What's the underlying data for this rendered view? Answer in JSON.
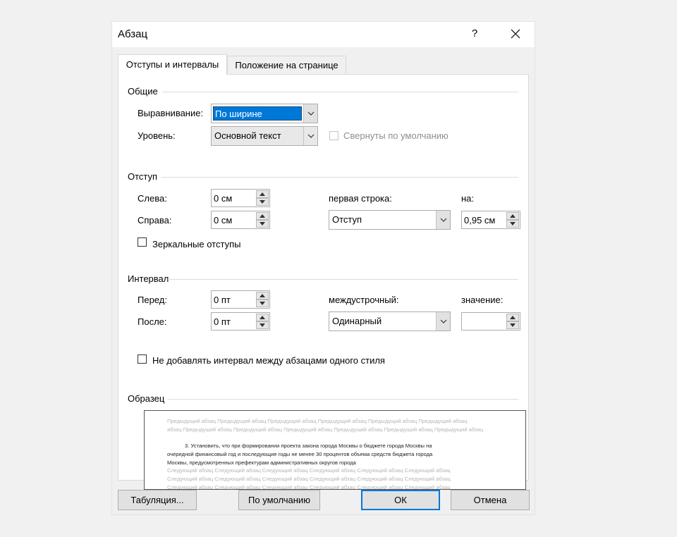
{
  "dialog": {
    "title": "Абзац",
    "help": "?"
  },
  "tabs": [
    {
      "label": "Отступы и интервалы",
      "active": true
    },
    {
      "label": "Положение на странице",
      "active": false
    }
  ],
  "general": {
    "section_title": "Общие",
    "alignment_label": "Выравнивание:",
    "alignment_value": "По ширине",
    "level_label": "Уровень:",
    "level_value": "Основной текст",
    "collapsed_label": "Свернуты по умолчанию",
    "collapsed_checked": false
  },
  "indent": {
    "section_title": "Отступ",
    "left_label": "Слева:",
    "left_value": "0 см",
    "right_label": "Справа:",
    "right_value": "0 см",
    "first_line_label": "первая строка:",
    "first_line_value": "Отступ",
    "by_label": "на:",
    "by_value": "0,95 см",
    "mirror_label": "Зеркальные отступы",
    "mirror_checked": false
  },
  "spacing": {
    "section_title": "Интервал",
    "before_label": "Перед:",
    "before_value": "0 пт",
    "after_label": "После:",
    "after_value": "0 пт",
    "line_label": "междустрочный:",
    "line_value": "Одинарный",
    "at_label": "значение:",
    "at_value": "",
    "no_space_label": "Не добавлять интервал между абзацами одного стиля",
    "no_space_checked": false
  },
  "preview": {
    "section_title": "Образец",
    "prev_line1": "Предыдущий абзац Предыдущий абзац Предыдущий абзац Предыдущий абзац Предыдущий абзац Предыдущий абзац",
    "prev_line2": "абзац Предыдущий абзац Предыдущий абзац Предыдущий абзац Предыдущий абзац Предыдущий абзац Предыдущий абзац",
    "main_line1": "3. Установить, что при формировании проекта закона города Москвы о бюджете города Москвы на",
    "main_line2": "очередной финансовый год и последующие годы не менее 30 процентов объема средств бюджета города",
    "main_line3": "Москвы, предусмотренных префектурам административных округов города",
    "next_line1": "Следующий абзац Следующий абзац Следующий абзац Следующий абзац Следующий абзац Следующий абзац",
    "next_line2": "Следующий абзац Следующий абзац Следующий абзац Следующий абзац Следующий абзац Следующий абзац",
    "next_line3": "Следующий абзац Следующий абзац Следующий абзац Следующий абзац Следующий абзац Следующий абзац"
  },
  "buttons": {
    "tabs_label": "Табуляция...",
    "default_label": "По умолчанию",
    "ok_label": "ОК",
    "cancel_label": "Отмена"
  },
  "colors": {
    "accent": "#0078d7",
    "preview_gray": "#b5b5b5"
  }
}
